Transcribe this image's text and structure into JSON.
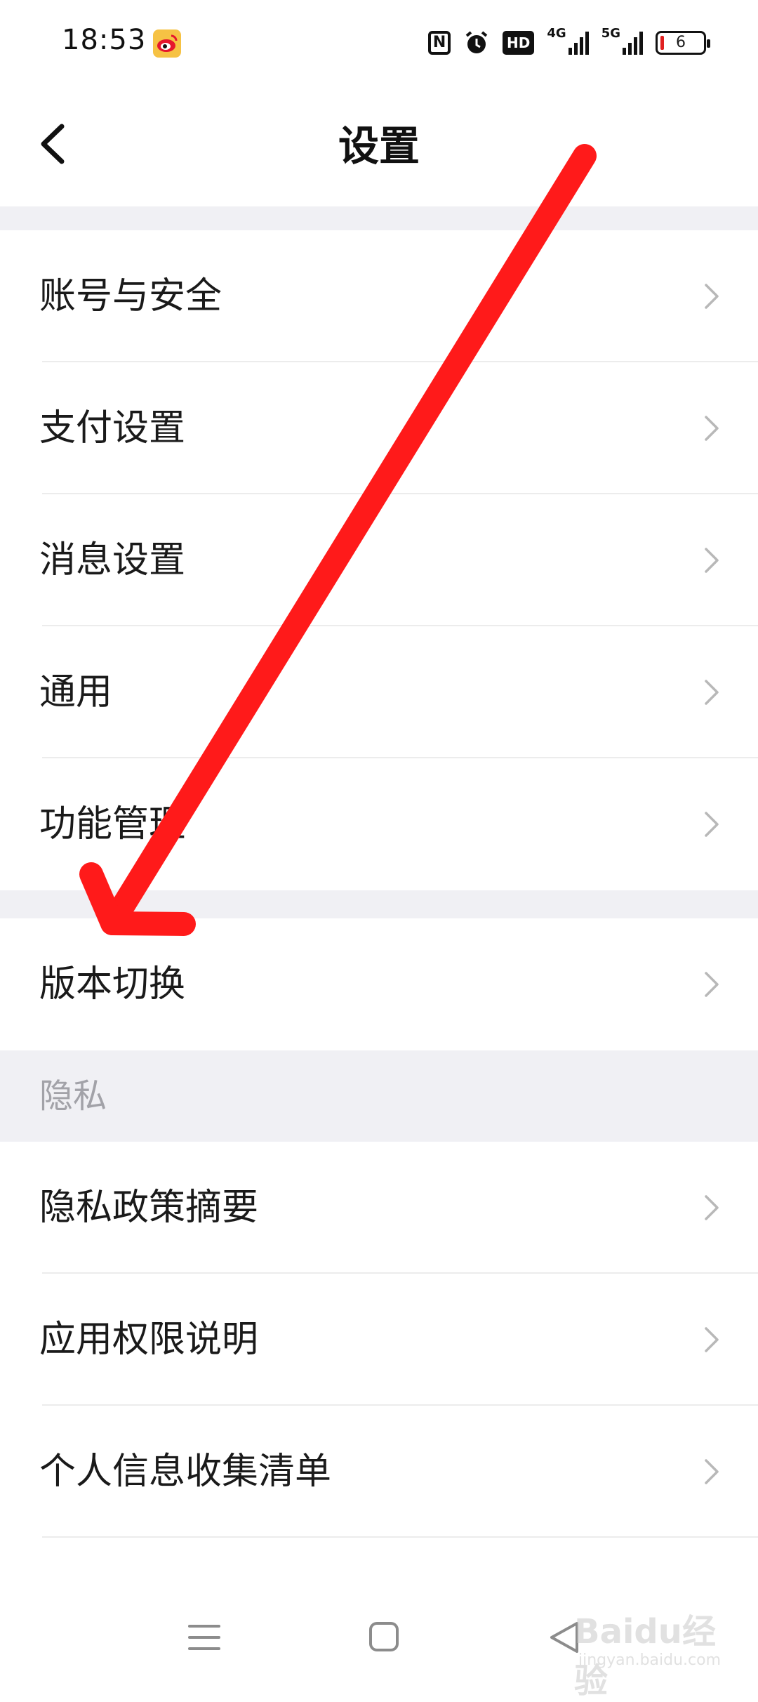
{
  "status_bar": {
    "time": "18:53",
    "hd_label": "HD",
    "net_4g": "4G",
    "net_5g": "5G",
    "battery_level": "6",
    "nfc_label": "N"
  },
  "header": {
    "title": "设置"
  },
  "group1": [
    {
      "label": "账号与安全"
    },
    {
      "label": "支付设置"
    },
    {
      "label": "消息设置"
    },
    {
      "label": "通用"
    },
    {
      "label": "功能管理"
    }
  ],
  "group2": [
    {
      "label": "版本切换"
    }
  ],
  "privacy_section": {
    "title": "隐私",
    "items": [
      {
        "label": "隐私政策摘要"
      },
      {
        "label": "应用权限说明"
      },
      {
        "label": "个人信息收集清单"
      }
    ]
  },
  "watermark": {
    "text": "Baidu经验",
    "sub": "jingyan.baidu.com"
  },
  "colors": {
    "annotation_arrow": "#ff1a1a",
    "section_bg": "#f0f0f4",
    "section_text": "#a2a2a8"
  }
}
